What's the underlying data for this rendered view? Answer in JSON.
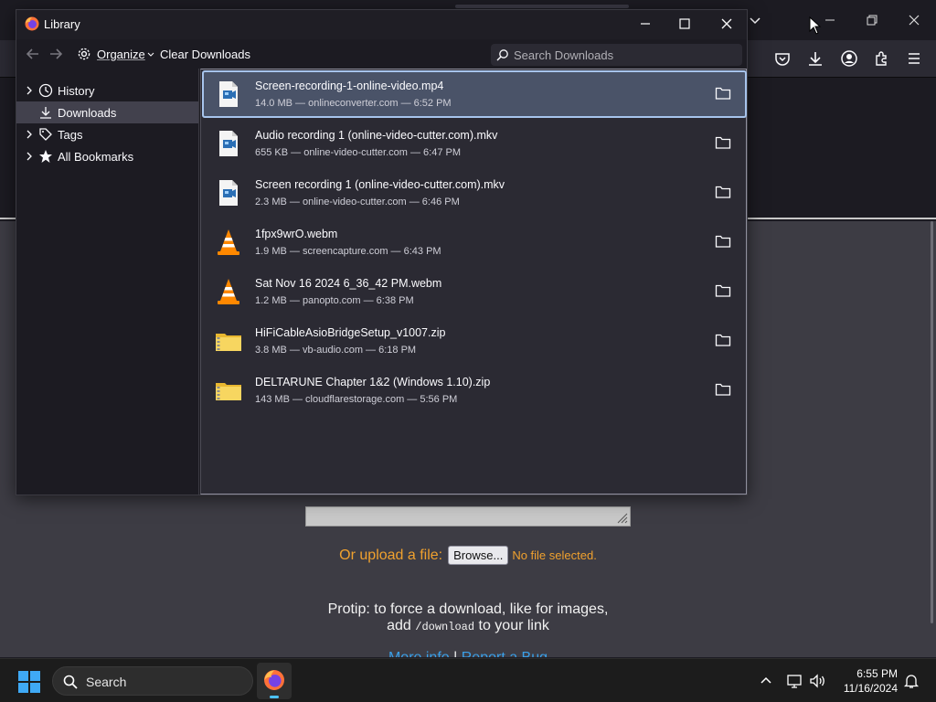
{
  "library": {
    "title": "Library",
    "toolbar": {
      "organize_label": "Organize",
      "clear_label": "Clear Downloads",
      "search_placeholder": "Search Downloads"
    },
    "sidebar": [
      {
        "label": "History",
        "icon": "clock-icon",
        "expandable": true
      },
      {
        "label": "Downloads",
        "icon": "download-icon",
        "expandable": false,
        "selected": true
      },
      {
        "label": "Tags",
        "icon": "tag-icon",
        "expandable": true
      },
      {
        "label": "All Bookmarks",
        "icon": "star-icon",
        "expandable": true
      }
    ],
    "downloads": [
      {
        "name": "Screen-recording-1-online-video.mp4",
        "meta": "14.0 MB — onlineconverter.com — 6:52 PM",
        "icon": "video-file-icon",
        "selected": true
      },
      {
        "name": "Audio recording 1 (online-video-cutter.com).mkv",
        "meta": "655 KB — online-video-cutter.com — 6:47 PM",
        "icon": "video-file-icon"
      },
      {
        "name": "Screen recording 1 (online-video-cutter.com).mkv",
        "meta": "2.3 MB — online-video-cutter.com — 6:46 PM",
        "icon": "video-file-icon"
      },
      {
        "name": "1fpx9wrO.webm",
        "meta": "1.9 MB — screencapture.com — 6:43 PM",
        "icon": "vlc-cone-icon"
      },
      {
        "name": "Sat Nov 16 2024 6_36_42 PM.webm",
        "meta": "1.2 MB — panopto.com — 6:38 PM",
        "icon": "vlc-cone-icon"
      },
      {
        "name": "HiFiCableAsioBridgeSetup_v1007.zip",
        "meta": "3.8 MB — vb-audio.com — 6:18 PM",
        "icon": "zip-folder-icon"
      },
      {
        "name": "DELTARUNE Chapter 1&2 (Windows 1.10).zip",
        "meta": "143 MB — cloudflarestorage.com — 5:56 PM",
        "icon": "zip-folder-icon"
      }
    ]
  },
  "page": {
    "upload_label": "Or upload a file:",
    "browse_label": "Browse...",
    "file_status": "No file selected.",
    "protip_line1": "Protip: to force a download, like for images,",
    "protip_add": "add",
    "protip_code": "/download",
    "protip_end": "to your link",
    "link_more": "More info",
    "link_sep": "|",
    "link_report": "Report a Bug"
  },
  "taskbar": {
    "search_label": "Search",
    "time": "6:55 PM",
    "date": "11/16/2024"
  },
  "colors": {
    "accent_orange": "#f0a12e",
    "selection_bg": "#4a5368",
    "selection_border": "#a7c4ec",
    "link_blue": "#3aa0e8"
  }
}
